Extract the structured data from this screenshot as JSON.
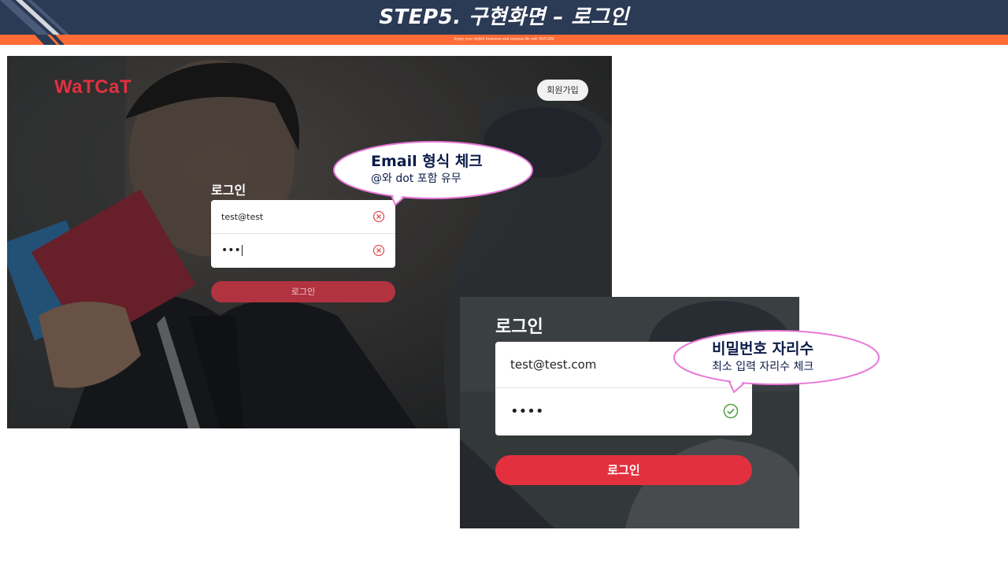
{
  "header": {
    "title": "STEP5.   구현화면 – 로그인",
    "subtitle": "Enjoy your stylish business and campus life with BIZCAM"
  },
  "screen1": {
    "logo": "WaTCaT",
    "signup_label": "회원가입",
    "login_label": "로그인",
    "email_value": "test@test",
    "password_value": "•••",
    "email_status_icon": "error-circle-icon",
    "password_status_icon": "error-circle-icon",
    "login_button_label": "로그인"
  },
  "screen2": {
    "login_label": "로그인",
    "email_value": "test@test.com",
    "password_value": "••••",
    "password_status_icon": "check-circle-icon",
    "login_button_label": "로그인"
  },
  "callouts": {
    "email": {
      "title": "Email 형식 체크",
      "subtitle": "@와 dot 포함 유무"
    },
    "password": {
      "title": "비밀번호 자리수",
      "subtitle": "최소 입력 자리수 체크"
    }
  },
  "colors": {
    "header_bg": "#2b3a55",
    "accent_orange": "#ff6b35",
    "brand_red": "#e2303f",
    "error_red": "#e05555",
    "success_green": "#5aa64a",
    "callout_border": "#e878d8"
  }
}
